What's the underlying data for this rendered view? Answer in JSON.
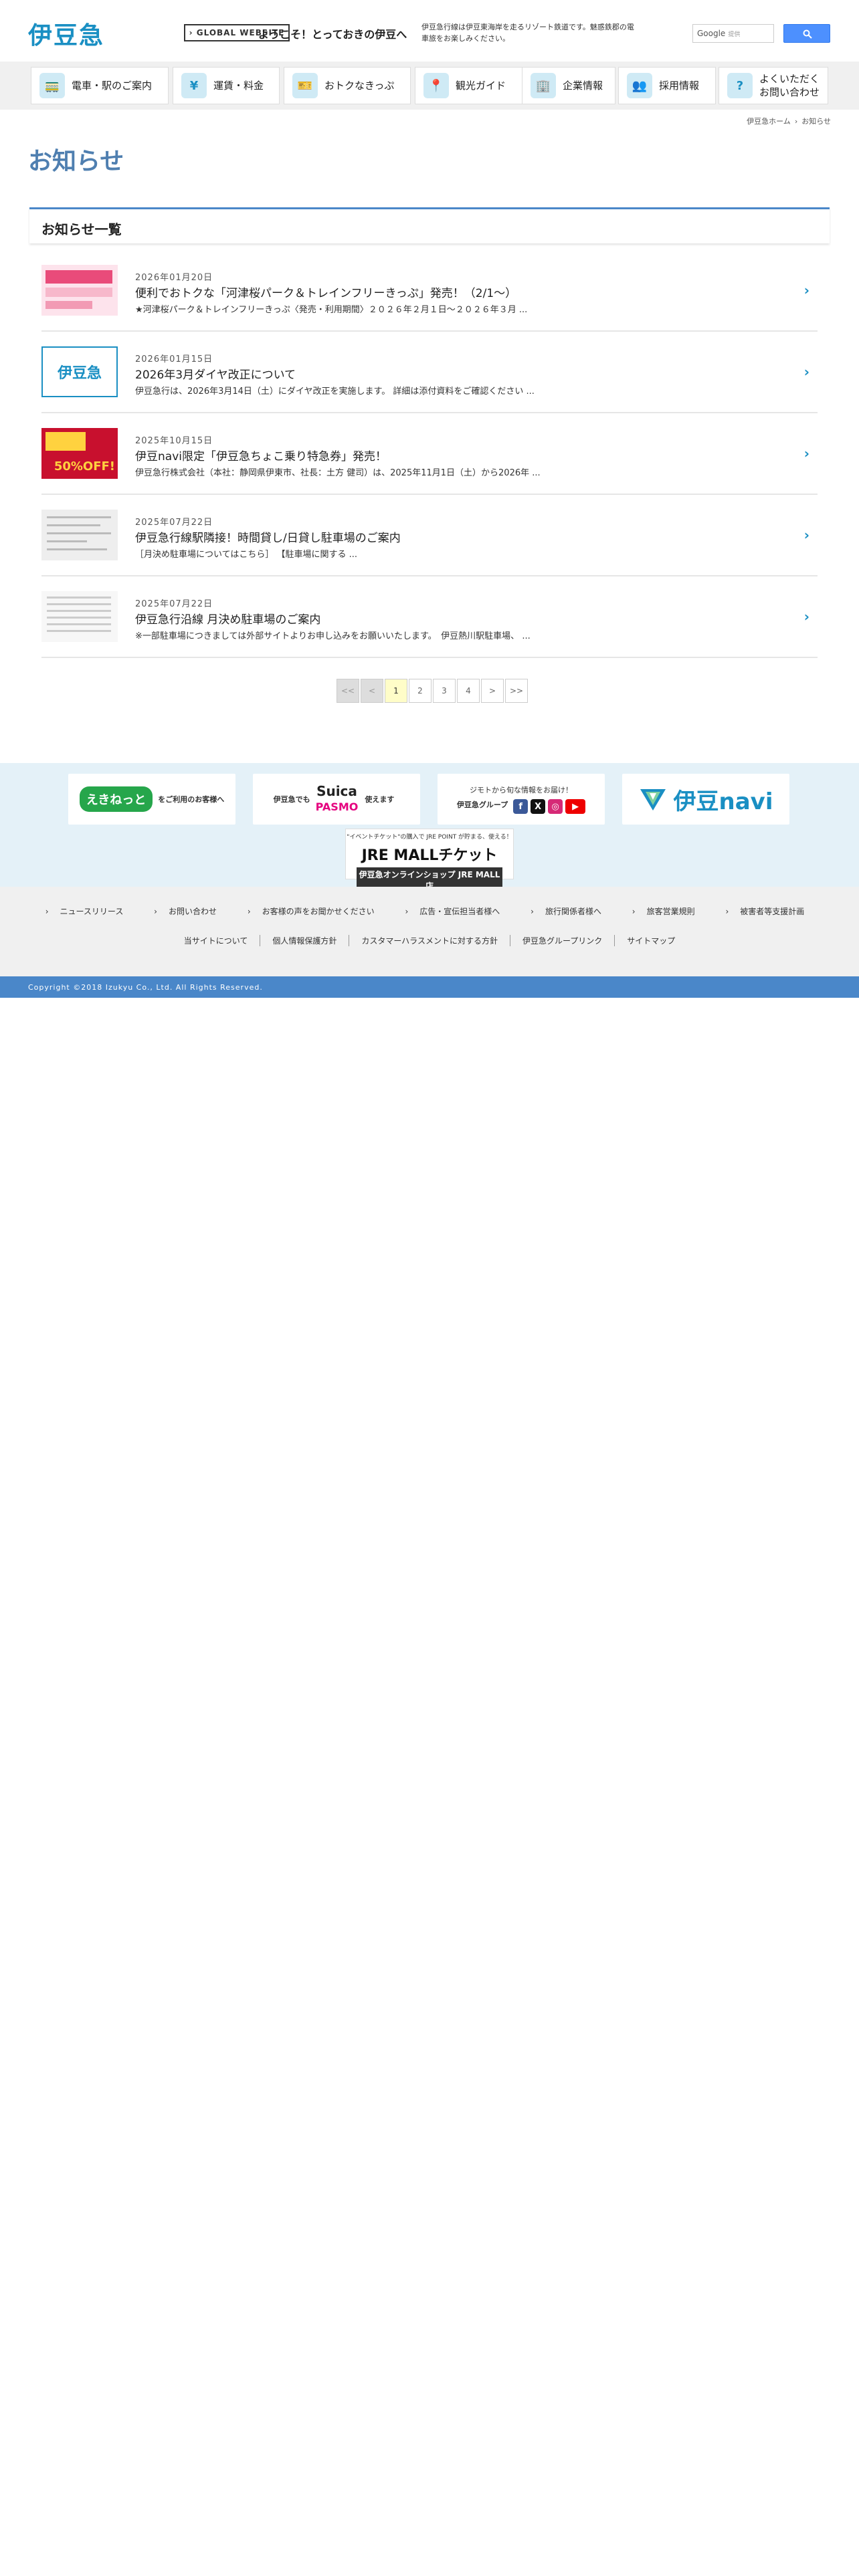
{
  "header": {
    "logo": "伊豆急",
    "global_website": "GLOBAL WEBSITE",
    "welcome": "ようこそ！とっておきの伊豆へ",
    "description": "伊豆急行線は伊豆東海岸を走るリゾート鉄道です。魅惑鉄郡の電車旅をお楽しみください。",
    "search_label": "Google",
    "search_hint": "提供"
  },
  "nav": [
    {
      "label": "電車・駅のご案内",
      "icon": "train-icon",
      "glyph": "🚃"
    },
    {
      "label": "運賃・料金",
      "icon": "yen-icon",
      "glyph": "¥"
    },
    {
      "label": "おトクなきっぷ",
      "icon": "ticket-icon",
      "glyph": "🎫"
    },
    {
      "label": "観光ガイド",
      "icon": "map-pin-icon",
      "glyph": "📍"
    },
    {
      "label": "企業情報",
      "icon": "building-icon",
      "glyph": "🏢"
    },
    {
      "label": "採用情報",
      "icon": "recruit-icon",
      "glyph": "👥"
    },
    {
      "label_line1": "よくいただく",
      "label_line2": "お問い合わせ",
      "icon": "question-icon",
      "glyph": "?"
    }
  ],
  "breadcrumb": {
    "home": "伊豆急ホーム",
    "current": "お知らせ"
  },
  "page_title": "お知らせ",
  "news": {
    "heading": "お知らせ一覧",
    "items": [
      {
        "date": "2026年01月20日",
        "title": "便利でおトクな「河津桜パーク＆トレインフリーきっぷ」発売！（2/1～）",
        "summary": "★河津桜パーク＆トレインフリーきっぷ〈発売・利用期間〉２０２６年２月１日～２０２６年３月 ...",
        "thumb_text": ""
      },
      {
        "date": "2026年01月15日",
        "title": "2026年3月ダイヤ改正について",
        "summary": "伊豆急行は、2026年3月14日（土）にダイヤ改正を実施します。 詳細は添付資料をご確認ください ...",
        "thumb_text": "伊豆急"
      },
      {
        "date": "2025年10月15日",
        "title": "伊豆navi限定「伊豆急ちょこ乗り特急券」発売！",
        "summary": "伊豆急行株式会社（本社：静岡県伊東市、社長：土方 健司）は、2025年11月1日（土）から2026年 ...",
        "thumb_text": "50%OFF!"
      },
      {
        "date": "2025年07月22日",
        "title": "伊豆急行線駅隣接！時間貸し/日貸し駐車場のご案内",
        "summary": "［月決め駐車場についてはこちら］ 【駐車場に関する ...",
        "thumb_text": ""
      },
      {
        "date": "2025年07月22日",
        "title": "伊豆急行沿線 月決め駐車場のご案内",
        "summary": "※一部駐車場につきましては外部サイトよりお申し込みをお願いいたします。　伊豆熱川駅駐車場、 ...",
        "thumb_text": ""
      }
    ]
  },
  "pagination": {
    "first": "<<",
    "prev": "<",
    "pages": [
      "1",
      "2",
      "3",
      "4"
    ],
    "next": ">",
    "last": ">>"
  },
  "banners": {
    "ekinet": {
      "main": "えきねっと",
      "sub": "をご利用のお客様へ"
    },
    "suica": {
      "prefix": "伊豆急でも",
      "suica": "Suica",
      "pasmo": "PASMO",
      "suffix": "使えます"
    },
    "sns": {
      "line1": "ジモトから旬な情報をお届け！",
      "line2": "伊豆急グループ"
    },
    "izunavi": {
      "label": "伊豆navi"
    },
    "jremall": {
      "line1": "\"イベントチケット\"の購入で JRE POINT が貯まる、使える！",
      "line2": "JRE MALLチケット",
      "line3": "伊豆急オンラインショップ JRE MALL店"
    }
  },
  "footer": {
    "links_primary": [
      "ニュースリリース",
      "お問い合わせ",
      "お客様の声をお聞かせください",
      "広告・宣伝担当者様へ",
      "旅行関係者様へ",
      "旅客営業規則",
      "被害者等支援計画"
    ],
    "links_secondary": [
      "当サイトについて",
      "個人情報保護方針",
      "カスタマーハラスメントに対する方針",
      "伊豆急グループリンク",
      "サイトマップ"
    ],
    "copyright": "Copyright ©2018 Izukyu Co., Ltd. All Rights Reserved."
  },
  "colors": {
    "brand": "#1a8fc3",
    "title": "#4f7fb0",
    "accent_bar": "#4a87c9",
    "current_page": "#fffdc8"
  }
}
